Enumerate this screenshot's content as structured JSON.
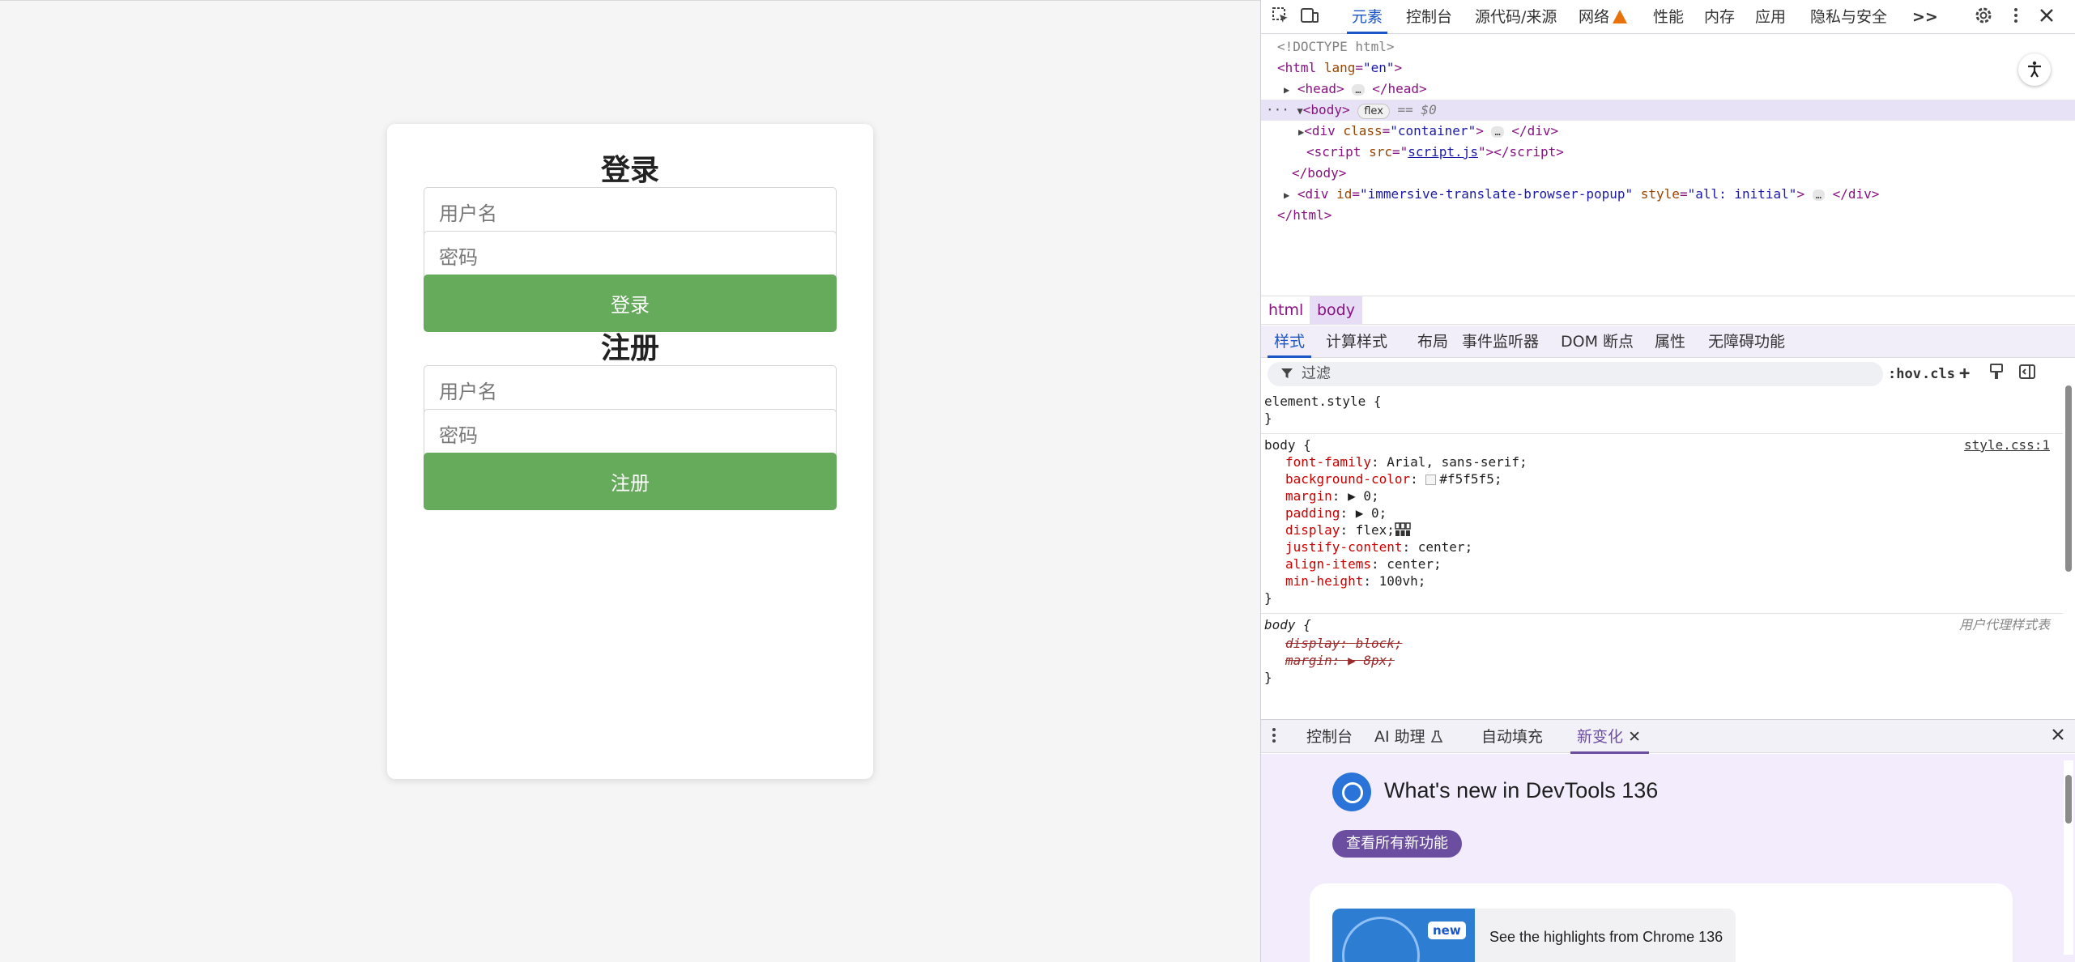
{
  "login": {
    "title": "登录",
    "username_placeholder": "用户名",
    "password_placeholder": "密码",
    "button": "登录"
  },
  "register": {
    "title": "注册",
    "username_placeholder": "用户名",
    "password_placeholder": "密码",
    "button": "注册"
  },
  "devtools": {
    "tabs": [
      "元素",
      "控制台",
      "源代码/来源",
      "网络",
      "性能",
      "内存",
      "应用",
      "隐私与安全"
    ],
    "more_icon": ">>",
    "dom": {
      "doctype": "<!DOCTYPE html>",
      "html_open_tag": "html",
      "html_attr_name": "lang",
      "html_attr_value": "\"en\"",
      "head": "head",
      "body": "body",
      "body_badge": "flex",
      "body_eq": "== $0",
      "div_tag": "div",
      "div_attr_name": "class",
      "div_attr_value": "\"container\"",
      "script_tag": "script",
      "script_attr_name": "src",
      "script_attr_value": "script.js",
      "body_close": "</body>",
      "popup_tag": "div",
      "popup_id_name": "id",
      "popup_id_value": "\"immersive-translate-browser-popup\"",
      "popup_style_name": "style",
      "popup_style_value": "\"all: initial\"",
      "html_close": "</html>"
    },
    "breadcrumbs": [
      "html",
      "body"
    ],
    "subtabs": [
      "样式",
      "计算样式",
      "布局",
      "事件监听器",
      "DOM 断点",
      "属性",
      "无障碍功能"
    ],
    "filter_placeholder": "过滤",
    "filter_buttons": [
      ":hov",
      ".cls",
      "+"
    ],
    "styles": {
      "element_style": "element.style {",
      "close_brace": "}",
      "body_selector": "body {",
      "source_link": "style.css:1",
      "rules": [
        {
          "prop": "font-family",
          "value": "Arial, sans-serif;"
        },
        {
          "prop": "background-color",
          "value": "#f5f5f5;"
        },
        {
          "prop": "margin",
          "value": "▶ 0;"
        },
        {
          "prop": "padding",
          "value": "▶ 0;"
        },
        {
          "prop": "display",
          "value": "flex;"
        },
        {
          "prop": "justify-content",
          "value": "center;"
        },
        {
          "prop": "align-items",
          "value": "center;"
        },
        {
          "prop": "min-height",
          "value": "100vh;"
        }
      ],
      "ua_selector": "body {",
      "ua_label": "用户代理样式表",
      "ua_rules": [
        {
          "prop": "display",
          "value": "block;"
        },
        {
          "prop": "margin",
          "value": "▶ 8px;"
        }
      ]
    },
    "drawer_tabs": [
      "控制台",
      "AI 助理",
      "自动填充",
      "新变化"
    ],
    "whats_new": {
      "title": "What's new in DevTools 136",
      "button": "查看所有新功能",
      "badge": "new",
      "highlight": "See the highlights from Chrome 136"
    }
  },
  "colors": {
    "page_bg": "#f5f5f5",
    "button_green": "#66ab5b",
    "devtools_accent": "#1a56c8",
    "drawer_accent": "#6b4ea0"
  }
}
